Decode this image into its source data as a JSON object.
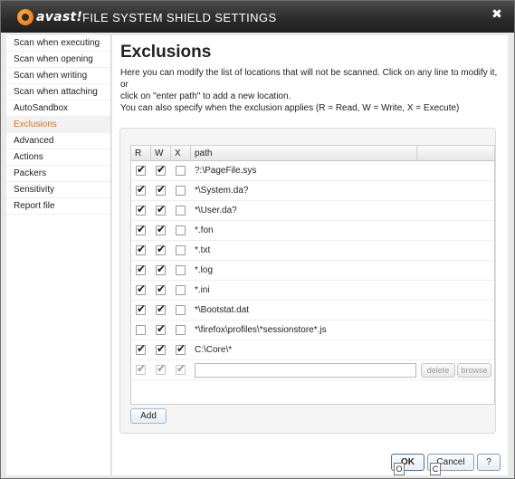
{
  "window": {
    "logo_text": "avast!",
    "title": "FILE SYSTEM SHIELD SETTINGS",
    "close_label": "✖"
  },
  "sidebar": {
    "items": [
      {
        "label": "Scan when executing"
      },
      {
        "label": "Scan when opening"
      },
      {
        "label": "Scan when writing"
      },
      {
        "label": "Scan when attaching"
      },
      {
        "label": "AutoSandbox"
      },
      {
        "label": "Exclusions",
        "active": true
      },
      {
        "label": "Advanced"
      },
      {
        "label": "Actions"
      },
      {
        "label": "Packers"
      },
      {
        "label": "Sensitivity"
      },
      {
        "label": "Report file"
      }
    ]
  },
  "main": {
    "heading": "Exclusions",
    "desc_line1": "Here you can modify the list of locations that will not be scanned. Click on any line to modify it, or",
    "desc_line2": "click on \"enter path\" to add a new location.",
    "desc_line3": "You can also specify when the exclusion applies (R = Read, W = Write, X = Execute)"
  },
  "grid": {
    "columns": [
      "R",
      "W",
      "X",
      "path"
    ],
    "rows": [
      {
        "r": true,
        "w": true,
        "x": false,
        "path": "?:\\PageFile.sys"
      },
      {
        "r": true,
        "w": true,
        "x": false,
        "path": "*\\System.da?"
      },
      {
        "r": true,
        "w": true,
        "x": false,
        "path": "*\\User.da?"
      },
      {
        "r": true,
        "w": true,
        "x": false,
        "path": "*.fon"
      },
      {
        "r": true,
        "w": true,
        "x": false,
        "path": "*.txt"
      },
      {
        "r": true,
        "w": true,
        "x": false,
        "path": "*.log"
      },
      {
        "r": true,
        "w": true,
        "x": false,
        "path": "*.ini"
      },
      {
        "r": true,
        "w": true,
        "x": false,
        "path": "*\\Bootstat.dat"
      },
      {
        "r": false,
        "w": true,
        "x": false,
        "path": "*\\firefox\\profiles\\*sessionstore*.js"
      },
      {
        "r": true,
        "w": true,
        "x": true,
        "path": "C:\\Core\\*"
      }
    ],
    "new_row": {
      "r": true,
      "w": true,
      "x": true,
      "path_value": ""
    },
    "delete_label": "delete",
    "browse_label": "browse"
  },
  "buttons": {
    "add": "Add",
    "ok": "OK",
    "cancel": "Cancel",
    "help": "?"
  },
  "ime_overlay": {
    "left_char": "O",
    "right_char": "C"
  }
}
